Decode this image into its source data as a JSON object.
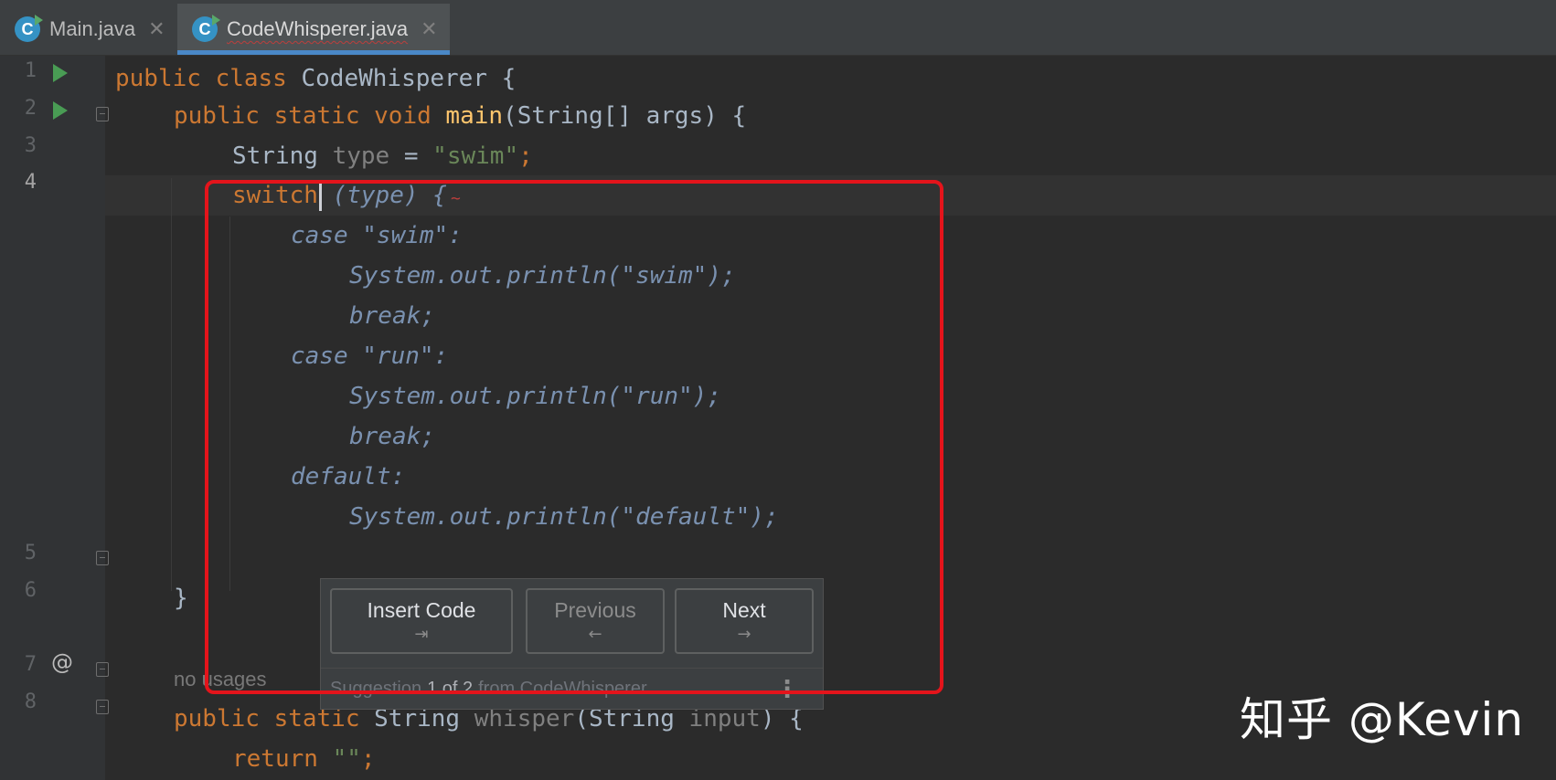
{
  "tabs": [
    {
      "label": "Main.java",
      "icon": "java-class-icon",
      "close": "✕"
    },
    {
      "label": "CodeWhisperer.java",
      "icon": "java-class-icon",
      "close": "✕",
      "active": true
    }
  ],
  "gutter": {
    "line_numbers": [
      "1",
      "2",
      "3",
      "4",
      "5",
      "6",
      "7",
      "8"
    ],
    "at_mark": "@"
  },
  "code": {
    "l1": {
      "kw": "public class ",
      "rest": "CodeWhisperer {"
    },
    "l2": {
      "kw": "public static void ",
      "fn": "main",
      "rest": "(String[] args) {"
    },
    "l3": {
      "type": "String ",
      "var": "type",
      "eq": " = ",
      "str": "\"swim\"",
      "semi": ";"
    },
    "l4": {
      "kw": "switch",
      "ghost": " (type) {"
    },
    "ghost_lines": [
      "case \"swim\":",
      "System.out.println(\"swim\");",
      "break;",
      "case \"run\":",
      "System.out.println(\"run\");",
      "break;",
      "default:",
      "System.out.println(\"default\");"
    ],
    "l5": "}",
    "hint": "no usages",
    "l7": {
      "kw": "public static ",
      "type": "String ",
      "muted1": "whisper",
      "p1": "(String ",
      "muted2": "input",
      "p2": ") {"
    },
    "l8": {
      "kw": "return ",
      "str": "\"\"",
      "semi": ";"
    }
  },
  "popup": {
    "insert_label": "Insert Code",
    "insert_shortcut": "⇥",
    "previous_label": "Previous",
    "previous_shortcut": "←",
    "next_label": "Next",
    "next_shortcut": "→",
    "footer_pre": "Suggestion",
    "footer_count": "1 of 2",
    "footer_post": "from CodeWhisperer",
    "menu": "⋮"
  },
  "watermark": "知乎 @Kevin",
  "colors": {
    "background": "#2b2b2b",
    "keyword": "#cc7832",
    "string": "#6a8759",
    "highlight_box": "#e4141b",
    "active_tab_indicator": "#4a88c7"
  }
}
